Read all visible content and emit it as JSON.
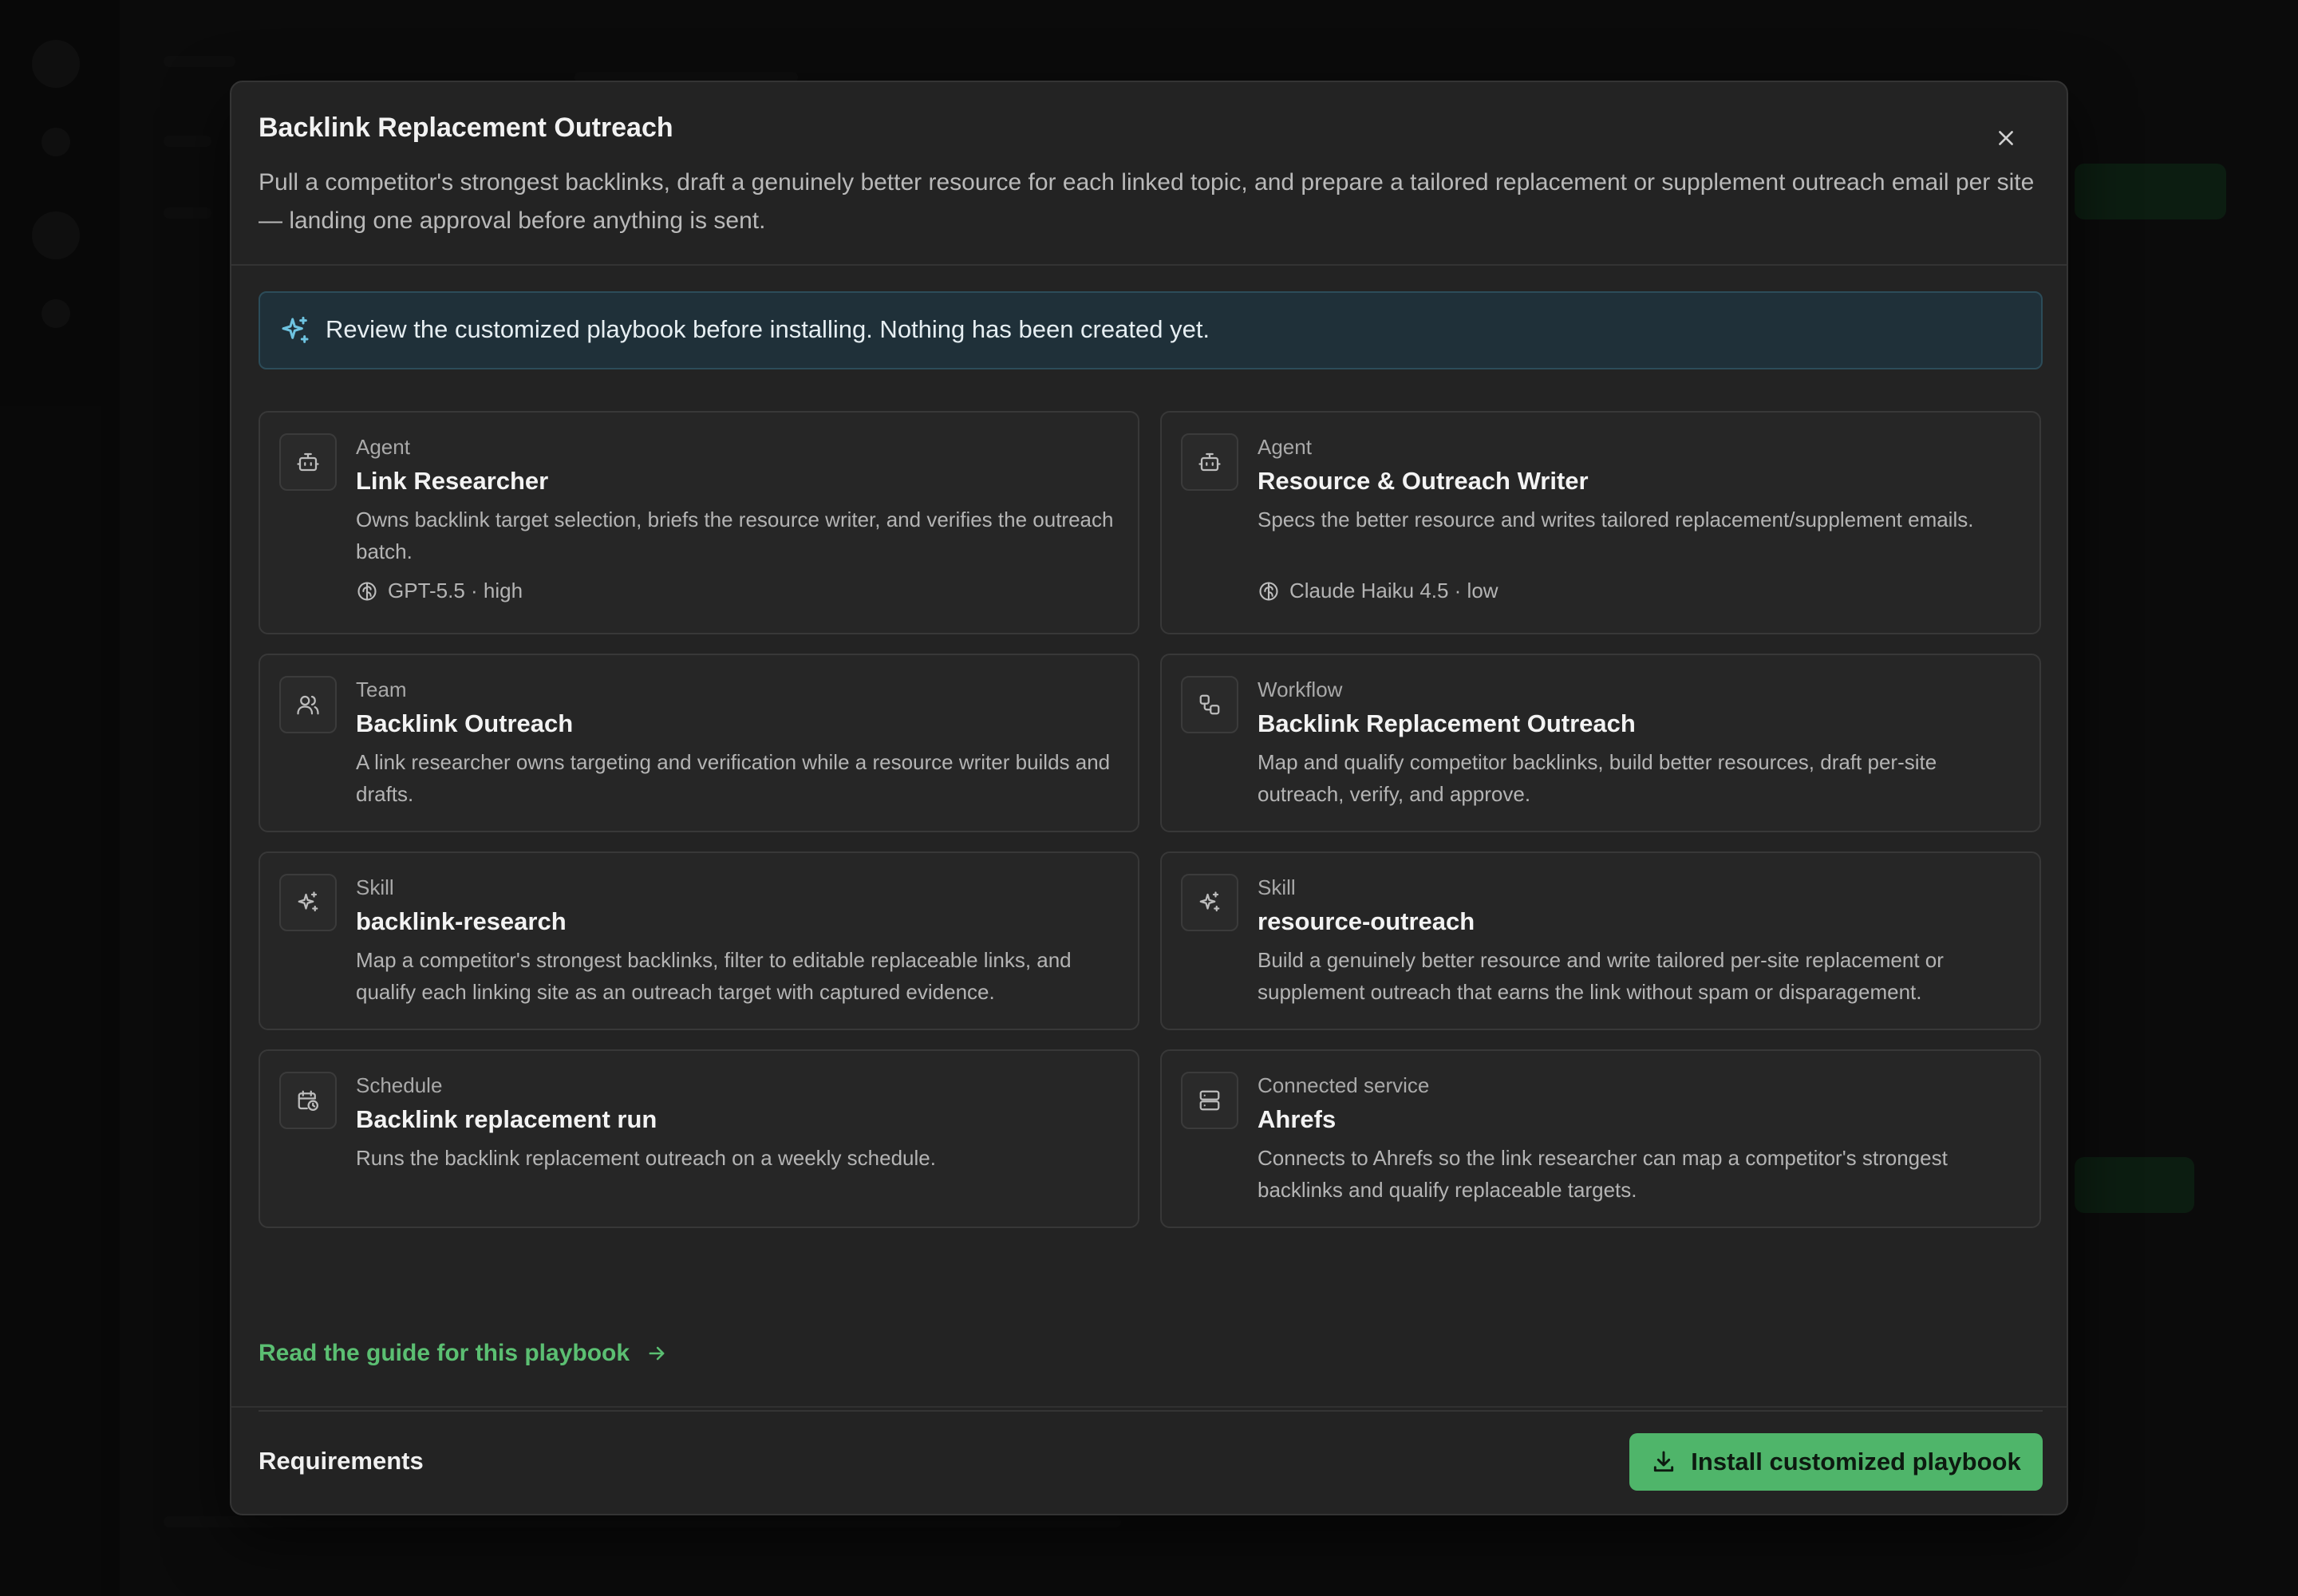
{
  "modal": {
    "title": "Backlink Replacement Outreach",
    "description": "Pull a competitor's strongest backlinks, draft a genuinely better resource for each linked topic, and prepare a tailored replacement or supplement outreach email per site — landing one approval before anything is sent."
  },
  "notice": {
    "text": "Review the customized playbook before installing. Nothing has been created yet.",
    "icon": "sparkles-icon"
  },
  "cards": [
    {
      "type": "Agent",
      "title": "Link Researcher",
      "description": "Owns backlink target selection, briefs the resource writer, and verifies the outreach batch.",
      "meta": "GPT-5.5 · high",
      "icon": "bot-icon",
      "meta_icon": "brain-icon"
    },
    {
      "type": "Agent",
      "title": "Resource & Outreach Writer",
      "description": "Specs the better resource and writes tailored replacement/supplement emails.",
      "meta": "Claude Haiku 4.5 · low",
      "icon": "bot-icon",
      "meta_icon": "brain-icon"
    },
    {
      "type": "Team",
      "title": "Backlink Outreach",
      "description": "A link researcher owns targeting and verification while a resource writer builds and drafts.",
      "icon": "users-icon"
    },
    {
      "type": "Workflow",
      "title": "Backlink Replacement Outreach",
      "description": "Map and qualify competitor backlinks, build better resources, draft per-site outreach, verify, and approve.",
      "icon": "workflow-icon"
    },
    {
      "type": "Skill",
      "title": "backlink-research",
      "description": "Map a competitor's strongest backlinks, filter to editable replaceable links, and qualify each linking site as an outreach target with captured evidence.",
      "icon": "sparkles-icon"
    },
    {
      "type": "Skill",
      "title": "resource-outreach",
      "description": "Build a genuinely better resource and write tailored per-site replacement or supplement outreach that earns the link without spam or disparagement.",
      "icon": "sparkles-icon"
    },
    {
      "type": "Schedule",
      "title": "Backlink replacement run",
      "description": "Runs the backlink replacement outreach on a weekly schedule.",
      "icon": "calendar-clock-icon"
    },
    {
      "type": "Connected service",
      "title": "Ahrefs",
      "description": "Connects to Ahrefs so the link researcher can map a competitor's strongest backlinks and qualify replaceable targets.",
      "icon": "server-icon"
    }
  ],
  "guide_link": {
    "label": "Read the guide for this playbook"
  },
  "requirements": {
    "heading": "Requirements"
  },
  "footer": {
    "install_label": "Install customized playbook"
  },
  "colors": {
    "accent_green": "#4fb56a",
    "link_green": "#5bbf72",
    "notice_bg": "#1f3039",
    "modal_bg": "#232323"
  }
}
